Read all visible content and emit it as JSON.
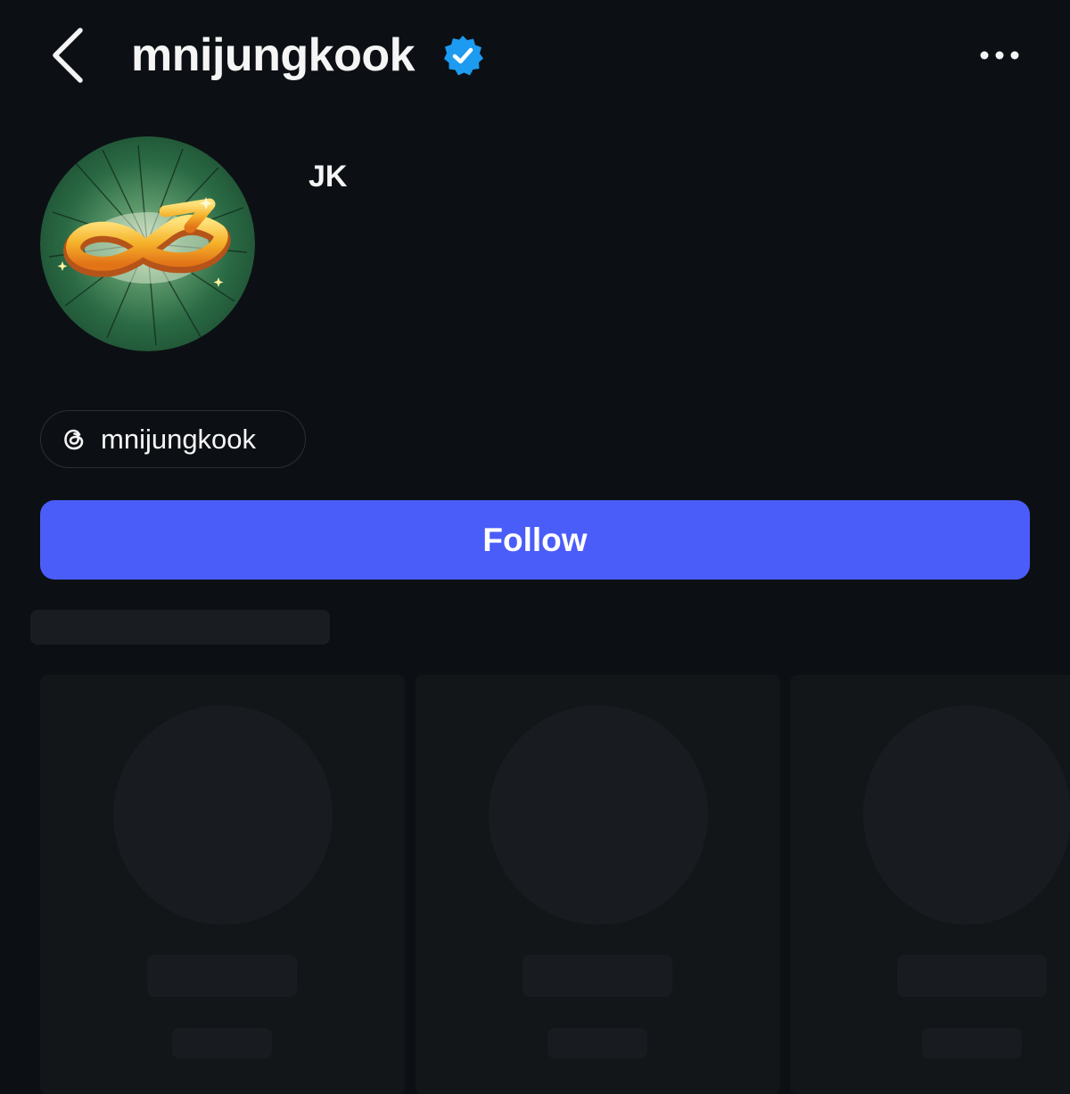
{
  "header": {
    "username": "mnijungkook",
    "verified": true,
    "back_icon": "chevron-left-icon",
    "more_icon": "more-horizontal-icon"
  },
  "profile": {
    "display_name": "JK",
    "avatar_icon": "golden-infinity-z-logo"
  },
  "threads_link": {
    "icon": "threads-icon",
    "label": "mnijungkook"
  },
  "actions": {
    "follow_label": "Follow"
  },
  "colors": {
    "background": "#0c1014",
    "text": "#f5f5f5",
    "follow_button": "#4a5df9",
    "verified_badge": "#1d9bf0",
    "skeleton": "#181c20"
  },
  "suggested": {
    "loading": true,
    "card_count": 3
  }
}
